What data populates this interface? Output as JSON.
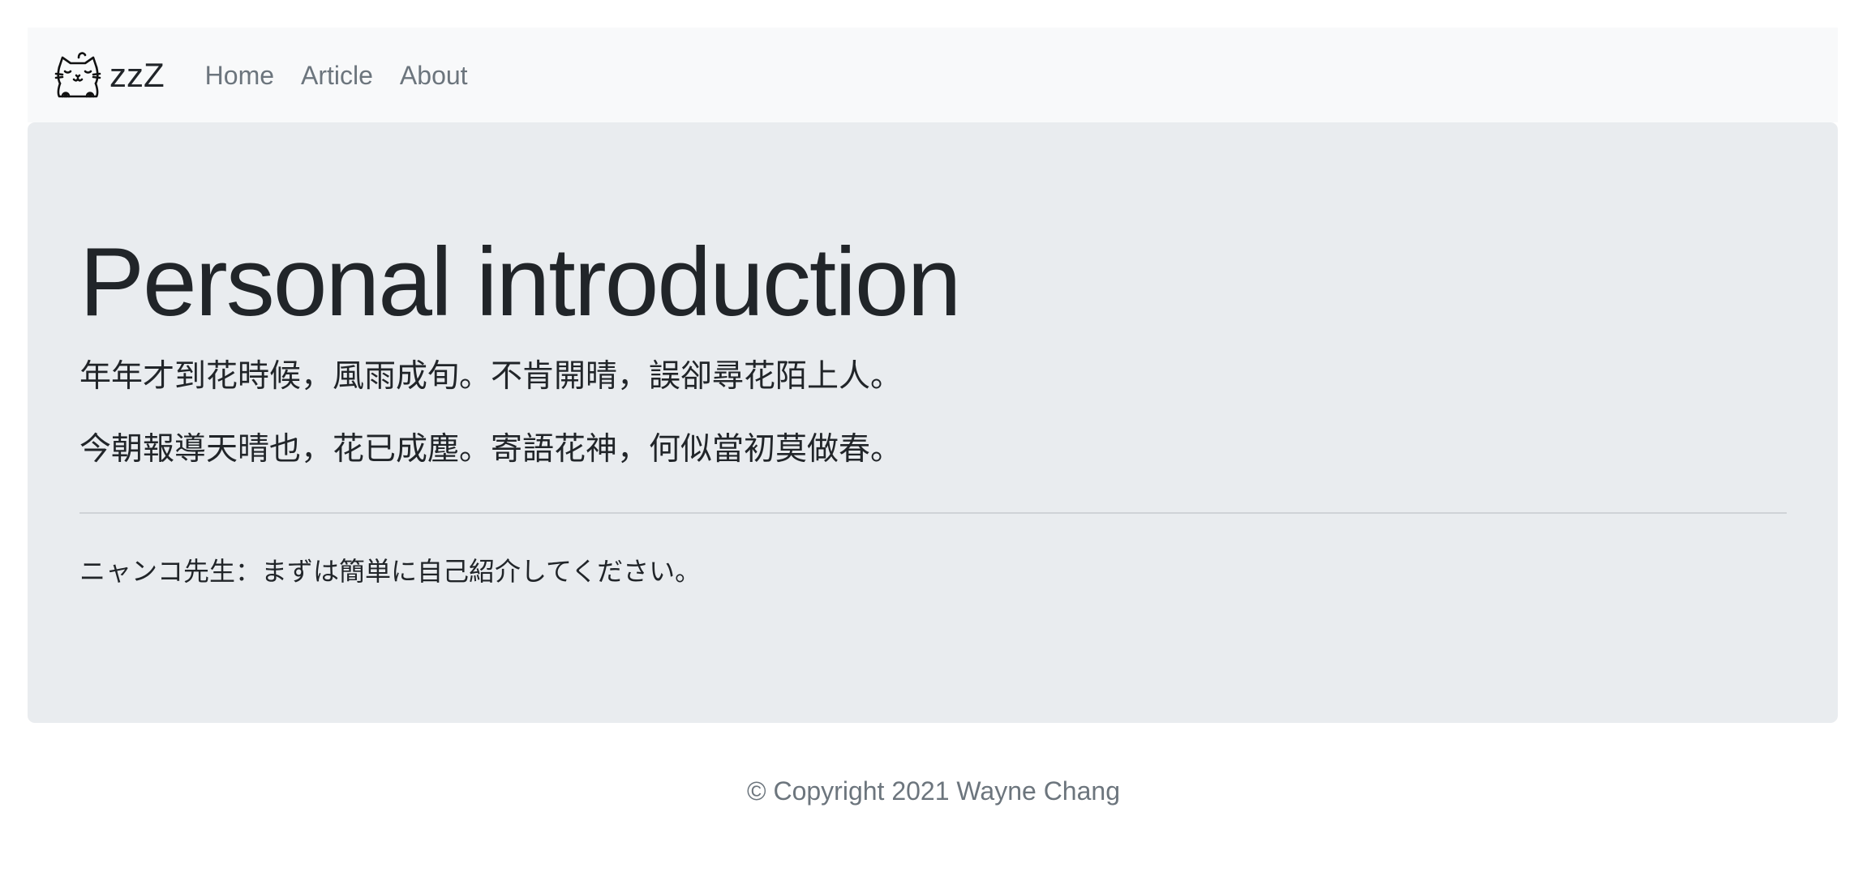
{
  "navbar": {
    "brand_text": "zzZ",
    "brand_logo_icon": "sleeping-cat-icon",
    "links": [
      "Home",
      "Article",
      "About"
    ]
  },
  "jumbotron": {
    "title": "Personal introduction",
    "poem_line_1": "年年才到花時候，風雨成旬。不肯開晴，誤卻尋花陌上人。",
    "poem_line_2": "今朝報導天晴也，花已成塵。寄語花神，何似當初莫做春。",
    "quote": "ニャンコ先生：まずは簡単に自己紹介してください。"
  },
  "footer": {
    "copyright": "© Copyright 2021 Wayne Chang"
  },
  "colors": {
    "navbar_bg": "#f8f9fa",
    "jumbotron_bg": "#e9ecef",
    "muted_text": "#6c757d",
    "body_text": "#212529"
  }
}
